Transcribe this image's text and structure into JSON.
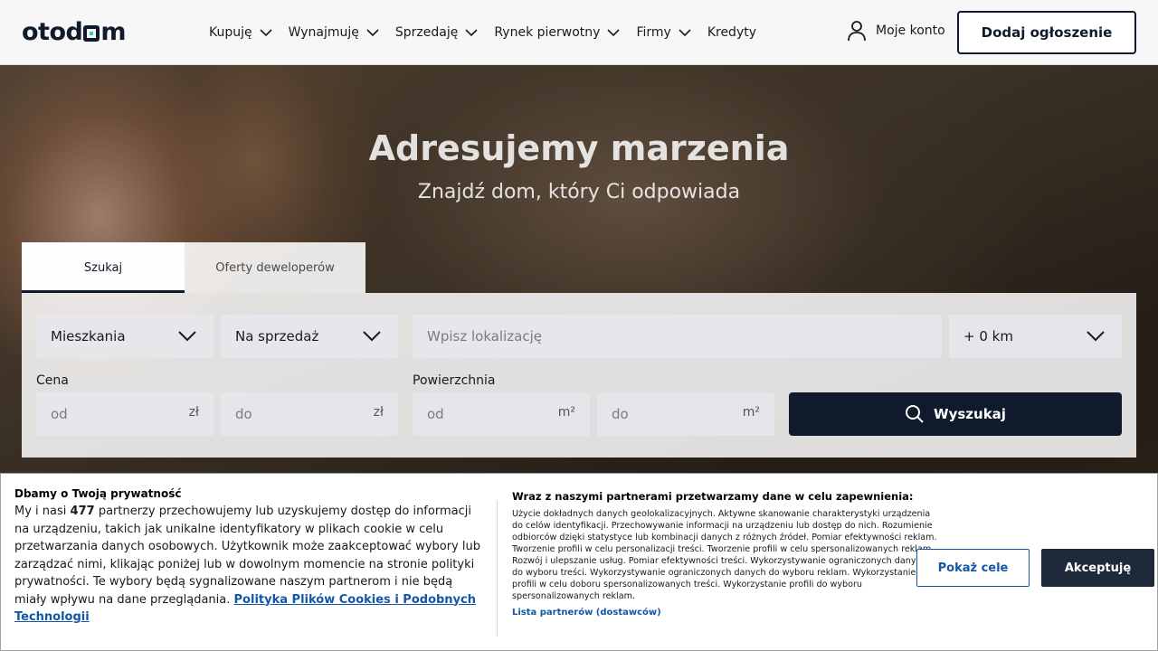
{
  "header": {
    "logo_parts": [
      "otod",
      "m"
    ],
    "nav": [
      {
        "label": "Kupuję",
        "has_dropdown": true
      },
      {
        "label": "Wynajmuję",
        "has_dropdown": true
      },
      {
        "label": "Sprzedaję",
        "has_dropdown": true
      },
      {
        "label": "Rynek pierwotny",
        "has_dropdown": true
      },
      {
        "label": "Firmy",
        "has_dropdown": true
      },
      {
        "label": "Kredyty",
        "has_dropdown": false
      }
    ],
    "account_label": "Moje konto",
    "add_listing_label": "Dodaj ogłoszenie"
  },
  "hero": {
    "title": "Adresujemy marzenia",
    "subtitle": "Znajdź dom, który Ci odpowiada"
  },
  "search": {
    "tabs": [
      {
        "label": "Szukaj",
        "active": true
      },
      {
        "label": "Oferty deweloperów",
        "active": false
      }
    ],
    "property_type": "Mieszkania",
    "transaction_type": "Na sprzedaż",
    "location_placeholder": "Wpisz lokalizację",
    "distance": "+ 0 km",
    "price_label": "Cena",
    "price_from": "od",
    "price_to": "do",
    "price_unit": "zł",
    "area_label": "Powierzchnia",
    "area_from": "od",
    "area_to": "do",
    "area_unit": "m²",
    "search_button": "Wyszukaj"
  },
  "cookie": {
    "title": "Dbamy o Twoją prywatność",
    "body_prefix": "My i nasi",
    "partner_count": "477",
    "body_rest": "partnerzy przechowujemy lub uzyskujemy dostęp do informacji na urządzeniu, takich jak unikalne identyfikatory w plikach cookie w celu przetwarzania danych osobowych. Użytkownik może zaakceptować wybory lub zarządzać nimi, klikając poniżej lub w dowolnym momencie na stronie polityki prywatności. Te wybory będą sygnalizowane naszym partnerom i nie będą miały wpływu na dane przeglądania.",
    "policy_link": "Polityka Plików Cookies i Podobnych Technologii",
    "mid_title": "Wraz z naszymi partnerami przetwarzamy dane w celu zapewnienia:",
    "mid_body": "Użycie dokładnych danych geolokalizacyjnych. Aktywne skanowanie charakterystyki urządzenia do celów identyfikacji. Przechowywanie informacji na urządzeniu lub dostęp do nich. Rozumienie odbiorców dzięki statystyce lub kombinacji danych z różnych źródeł. Pomiar efektywności reklam. Tworzenie profili w celu personalizacji treści. Tworzenie profili w celu spersonalizowanych reklam. Rozwój i ulepszanie usług. Pomiar efektywności treści. Wykorzystywanie ograniczonych danych do wyboru treści. Wykorzystywanie ograniczonych danych do wyboru reklam. Wykorzystanie profili w celu doboru spersonalizowanych treści. Wykorzystanie profili do wyboru spersonalizowanych reklam.",
    "partners_link": "Lista partnerów (dostawców)",
    "show_goals_button": "Pokaż cele",
    "accept_button": "Akceptuję"
  },
  "colors": {
    "brand_dark": "#0f1b2d",
    "logo_accent": "#2fd3a0",
    "link_blue": "#1257a8",
    "accept_bg": "#1e293b"
  }
}
